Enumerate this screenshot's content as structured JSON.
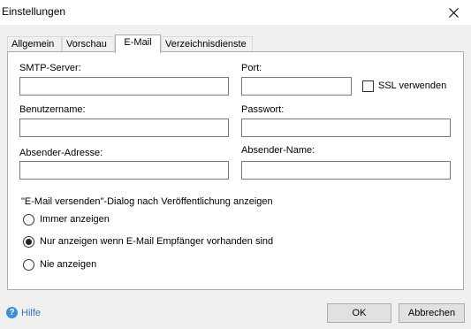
{
  "window": {
    "title": "Einstellungen"
  },
  "tabs": [
    {
      "label": "Allgemein"
    },
    {
      "label": "Vorschau"
    },
    {
      "label": "E-Mail"
    },
    {
      "label": "Verzeichnisdienste"
    }
  ],
  "active_tab": "E-Mail",
  "form": {
    "smtp_server_label": "SMTP-Server:",
    "smtp_server_value": "",
    "port_label": "Port:",
    "port_value": "",
    "ssl_label": "SSL verwenden",
    "ssl_checked": false,
    "username_label": "Benutzername:",
    "username_value": "",
    "password_label": "Passwort:",
    "password_value": "",
    "sender_address_label": "Absender-Adresse:",
    "sender_address_value": "",
    "sender_name_label": "Absender-Name:",
    "sender_name_value": ""
  },
  "dialog_option": {
    "heading": "\"E-Mail versenden\"-Dialog nach Veröffentlichung anzeigen",
    "options": [
      {
        "label": "Immer anzeigen",
        "checked": false
      },
      {
        "label": "Nur anzeigen wenn E-Mail Empfänger vorhanden sind",
        "checked": true
      },
      {
        "label": "Nie anzeigen",
        "checked": false
      }
    ]
  },
  "footer": {
    "help_label": "Hilfe",
    "ok_label": "OK",
    "cancel_label": "Abbrechen"
  }
}
